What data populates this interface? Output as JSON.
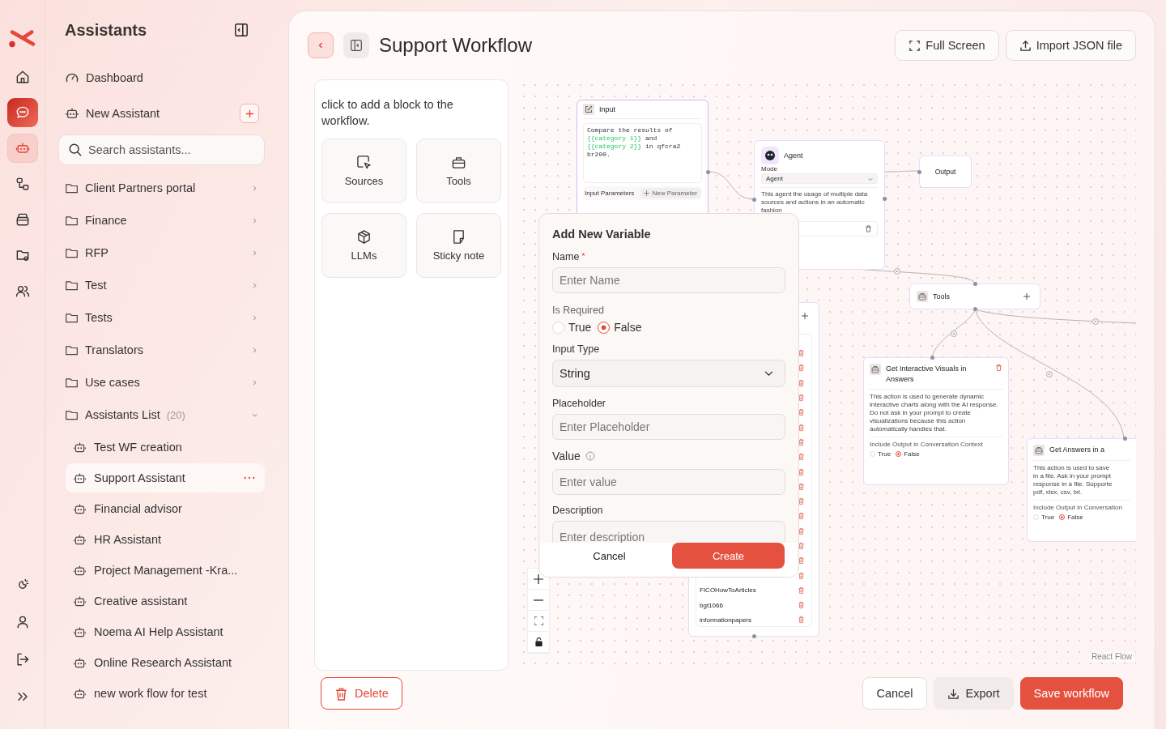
{
  "rail": {
    "top": [
      {
        "kind": "home",
        "selected": false,
        "highlighted": false
      },
      {
        "kind": "chat",
        "selected": true,
        "highlighted": false
      },
      {
        "kind": "bot",
        "selected": false,
        "highlighted": true
      },
      {
        "kind": "flow",
        "selected": false,
        "highlighted": false
      },
      {
        "kind": "store",
        "selected": false,
        "highlighted": false
      },
      {
        "kind": "folder-gear",
        "selected": false,
        "highlighted": false
      },
      {
        "kind": "users",
        "selected": false,
        "highlighted": false
      }
    ],
    "bottom": [
      {
        "kind": "theme",
        "selected": false,
        "highlighted": false
      },
      {
        "kind": "profile",
        "selected": false,
        "highlighted": false
      },
      {
        "kind": "logout",
        "selected": false,
        "highlighted": false
      },
      {
        "kind": "expand",
        "selected": false,
        "highlighted": false
      }
    ]
  },
  "sidebar": {
    "title": "Assistants",
    "links": [
      {
        "kind": "dashboard",
        "label": "Dashboard"
      },
      {
        "kind": "new",
        "label": "New Assistant"
      }
    ],
    "search": {
      "placeholder": "Search assistants..."
    },
    "folders": [
      {
        "label": "Client Partners portal",
        "expanded": false
      },
      {
        "label": "Finance",
        "expanded": false
      },
      {
        "label": "RFP",
        "expanded": false
      },
      {
        "label": "Test",
        "expanded": false
      },
      {
        "label": "Tests",
        "expanded": false
      },
      {
        "label": "Translators",
        "expanded": false
      },
      {
        "label": "Use cases",
        "expanded": false
      },
      {
        "label": "Assistants List",
        "count": "(20)",
        "expanded": true,
        "children": [
          {
            "label": "Test WF creation",
            "selected": false
          },
          {
            "label": "Support Assistant",
            "selected": true
          },
          {
            "label": "Financial advisor",
            "selected": false
          },
          {
            "label": "HR Assistant",
            "selected": false
          },
          {
            "label": "Project Management -Kra...",
            "selected": false
          },
          {
            "label": "Creative assistant",
            "selected": false
          },
          {
            "label": "Noema AI Help Assistant",
            "selected": false
          },
          {
            "label": "Online Research Assistant",
            "selected": false
          },
          {
            "label": "new work flow for test",
            "selected": false
          }
        ]
      }
    ]
  },
  "header": {
    "title": "Support Workflow",
    "buttons": [
      {
        "kind": "fullscreen",
        "label": "Full Screen"
      },
      {
        "kind": "import",
        "label": "Import JSON file"
      }
    ]
  },
  "blocks": {
    "hint": "click to add a block to the workflow.",
    "tiles": [
      {
        "kind": "sources",
        "label": "Sources"
      },
      {
        "kind": "tools",
        "label": "Tools"
      },
      {
        "kind": "llms",
        "label": "LLMs"
      },
      {
        "kind": "note",
        "label": "Sticky note"
      }
    ]
  },
  "canvas": {
    "nodes": [
      {
        "kind": "input",
        "title": "Input",
        "prompt": [
          {
            "kind": "plain",
            "text": "Compare the results of "
          },
          {
            "kind": "variable",
            "text": "{{category 1}}"
          },
          {
            "kind": "plain",
            "text": " and "
          },
          {
            "kind": "variable",
            "text": "{{category 2}}"
          },
          {
            "kind": "plain",
            "text": " in qfcra2 br200."
          }
        ],
        "params_label": "Input Parameters",
        "params_button": "New Parameter"
      },
      {
        "kind": "agent",
        "title": "Agent",
        "mode_label": "Mode",
        "mode": "Agent",
        "description": "This agent the usage of multiple data sources and actions in an automatic fashion"
      },
      {
        "kind": "output",
        "title": "Output"
      },
      {
        "kind": "tools",
        "title": "Tools"
      },
      {
        "kind": "action",
        "title": "Get Interactive Visuals in Answers",
        "description": "This action is used to generate dynamic interactive charts along with the AI response. Do not ask in your prompt to create visualizations because this action automatically handles that.",
        "option_label": "Include Output in Conversation Context",
        "options": [
          {
            "label": "True",
            "selected": false
          },
          {
            "label": "False",
            "selected": true
          }
        ]
      },
      {
        "kind": "action-cut",
        "title": "Get Answers in a",
        "description_lines": [
          "This action is used to save",
          "in a file. Ask in your prompt",
          "response in a file. Supporte",
          "pdf, xlsx, csv, txt."
        ],
        "option_label": "Include Output in Conversation",
        "options": [
          {
            "label": "True",
            "selected": false
          },
          {
            "label": "False",
            "selected": true
          }
        ]
      },
      {
        "kind": "knowledge",
        "rows": [
          {
            "kind": "covered"
          },
          {
            "kind": "covered"
          },
          {
            "kind": "covered"
          },
          {
            "kind": "covered"
          },
          {
            "kind": "covered"
          },
          {
            "kind": "covered"
          },
          {
            "kind": "covered"
          },
          {
            "kind": "covered"
          },
          {
            "kind": "covered"
          },
          {
            "kind": "covered"
          },
          {
            "kind": "covered"
          },
          {
            "kind": "covered"
          },
          {
            "kind": "covered"
          },
          {
            "kind": "covered"
          },
          {
            "kind": "covered"
          },
          {
            "kind": "covered"
          },
          {
            "kind": "named",
            "label": "FICOHowToArticles"
          },
          {
            "kind": "named",
            "label": "bgt1066"
          },
          {
            "kind": "named",
            "label": "informationpapers"
          }
        ]
      }
    ],
    "attribution": "React Flow"
  },
  "modal": {
    "title": "Add New Variable",
    "name": {
      "label": "Name",
      "required_mark": "*",
      "placeholder": "Enter Name"
    },
    "is_required": {
      "label": "Is Required",
      "options": [
        {
          "label": "True",
          "selected": false
        },
        {
          "label": "False",
          "selected": true
        }
      ]
    },
    "input_type": {
      "label": "Input Type",
      "value": "String"
    },
    "placeholder_field": {
      "label": "Placeholder",
      "placeholder": "Enter Placeholder"
    },
    "value_field": {
      "label": "Value",
      "placeholder": "Enter value"
    },
    "description_field": {
      "label": "Description",
      "placeholder": "Enter description"
    },
    "buttons": [
      {
        "kind": "cancel",
        "label": "Cancel"
      },
      {
        "kind": "primary",
        "label": "Create"
      }
    ]
  },
  "footer": {
    "delete": "Delete",
    "buttons": [
      {
        "kind": "plain",
        "label": "Cancel"
      },
      {
        "kind": "export",
        "label": "Export"
      },
      {
        "kind": "primary",
        "label": "Save workflow"
      }
    ]
  }
}
